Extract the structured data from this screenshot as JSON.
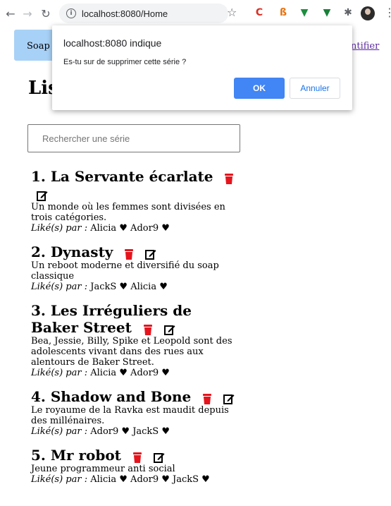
{
  "browser": {
    "url": "localhost:8080/Home",
    "icons": {
      "back": "back-arrow-icon",
      "forward": "forward-arrow-icon",
      "reload": "reload-icon",
      "info": "info-icon",
      "star": "bookmark-star-icon",
      "menu": "more-menu-icon"
    }
  },
  "header": {
    "brand": "Soap C",
    "link_right": "ntifier",
    "bar_color": "#a8d1f7"
  },
  "page": {
    "title": "Lis",
    "search_placeholder": "Rechercher une série"
  },
  "series": [
    {
      "title": "1. La Servante écarlate",
      "desc": "Un monde où les femmes sont divisées en trois catégories.",
      "likes_label": "Liké(s) par :",
      "likes": "Alicia ♥ Ador9 ♥"
    },
    {
      "title": "2. Dynasty",
      "desc": "Un reboot moderne et diversifié du soap classique",
      "likes_label": "Liké(s) par :",
      "likes": "JackS ♥ Alicia ♥"
    },
    {
      "title": "3. Les Irréguliers de Baker Street",
      "desc": "Bea, Jessie, Billy, Spike et Leopold sont des adolescents vivant dans des rues aux alentours de Baker Street.",
      "likes_label": "Liké(s) par :",
      "likes": "Alicia ♥ Ador9 ♥"
    },
    {
      "title": "4. Shadow and Bone",
      "desc": "Le royaume de la Ravka est maudit depuis des millénaires.",
      "likes_label": "Liké(s) par :",
      "likes": "Ador9 ♥ JackS ♥"
    },
    {
      "title": "5. Mr robot",
      "desc": "Jeune programmeur anti social",
      "likes_label": "Liké(s) par :",
      "likes": "Alicia ♥ Ador9 ♥ JackS ♥"
    }
  ],
  "dialog": {
    "title": "localhost:8080 indique",
    "message": "Es-tu sur de supprimer cette série ?",
    "ok": "OK",
    "cancel": "Annuler",
    "ok_color": "#4285f4"
  },
  "colors": {
    "delete_icon": "#e5141d",
    "edit_icon": "#000000"
  }
}
